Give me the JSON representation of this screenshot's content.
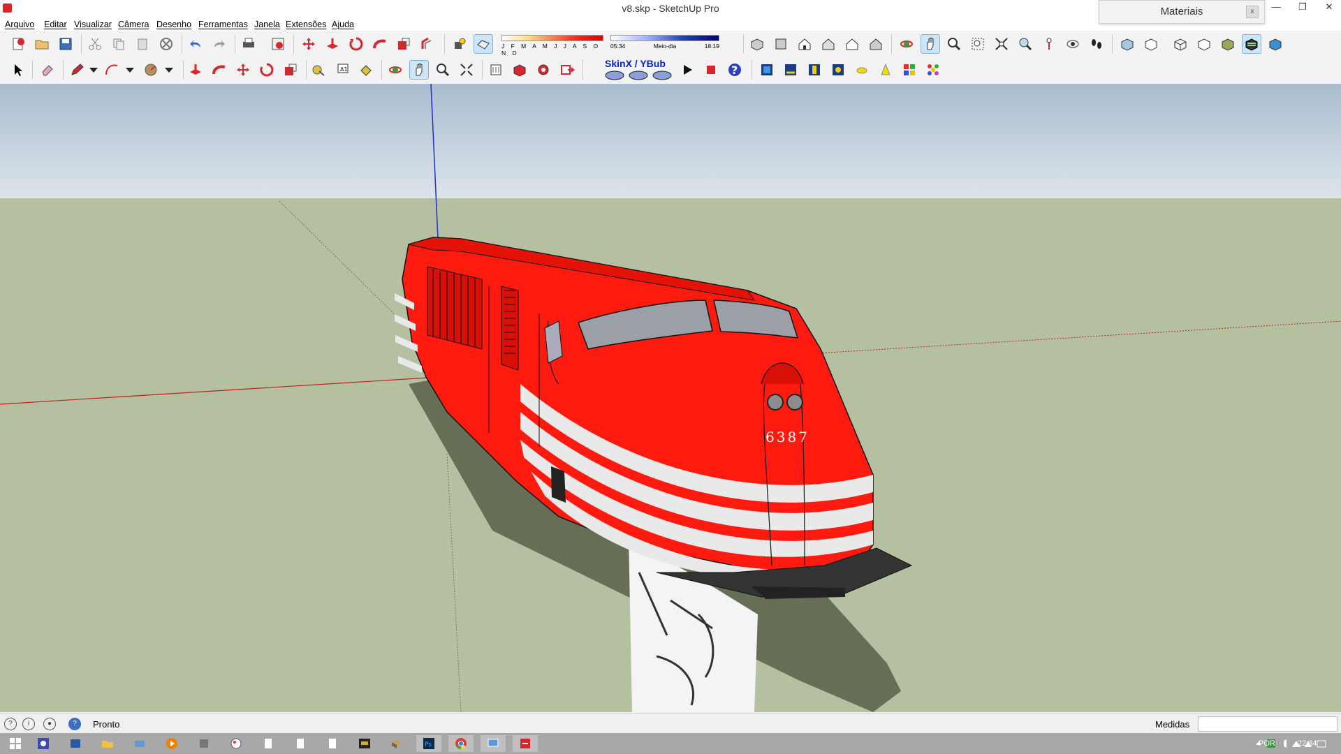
{
  "window": {
    "title": "v8.skp - SketchUp Pro",
    "minimize": "—",
    "restore": "❐",
    "close": "✕"
  },
  "panel": {
    "title": "Materiais",
    "close": "x"
  },
  "menu": [
    "Arquivo",
    "Editar",
    "Visualizar",
    "Câmera",
    "Desenho",
    "Ferramentas",
    "Janela",
    "Extensões",
    "Ajuda"
  ],
  "shadows": {
    "months": "J F M A M J J A S O N D",
    "time_start": "05:34",
    "time_mid": "Meio-dia",
    "time_end": "18:19"
  },
  "plugin": {
    "label": "SkinX / YBub"
  },
  "model": {
    "number": "6387"
  },
  "colors": {
    "locomotive": "#ff1a0f",
    "stripe": "#e9e9e9",
    "sky": "#c2ceda",
    "ground": "#b5c0a0",
    "shadow": "#666f56"
  },
  "status": {
    "text": "Pronto",
    "measure_label": "Medidas",
    "measure_value": ""
  },
  "taskbar": {
    "lang": "POR",
    "time": "22:34"
  }
}
